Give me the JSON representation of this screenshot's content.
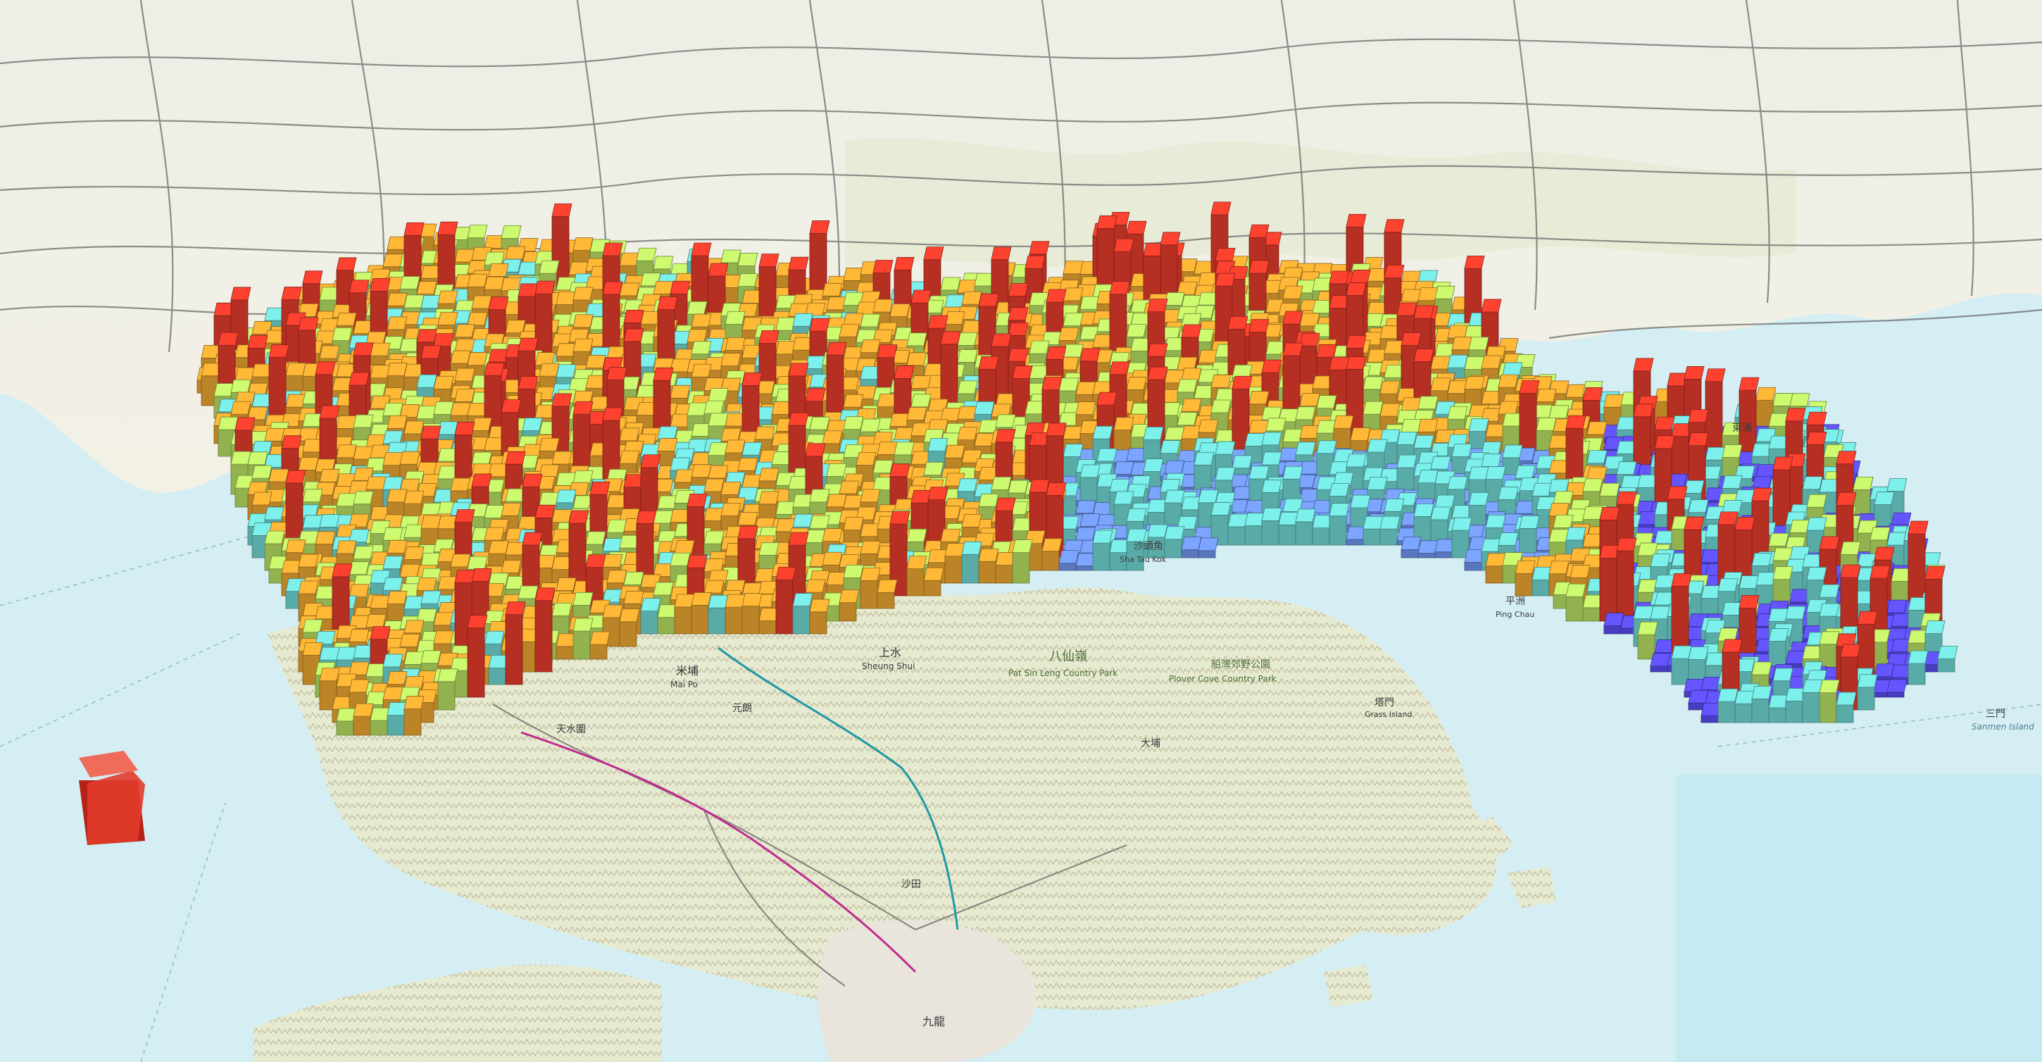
{
  "map": {
    "colors": {
      "water": "#d4eef3",
      "water_deep": "#bfe7ef",
      "land": "#f2f0e6",
      "land_green": "#dfe9c8",
      "hills": "#c9c2a6",
      "roads": "#6d6d6d",
      "rail_magenta": "#c02a8f",
      "rail_teal": "#1f99a4"
    },
    "extrusion_palette": [
      "#5a4cf0",
      "#6f93ee",
      "#6fd6d2",
      "#b7df63",
      "#e9a531",
      "#e23b2b"
    ],
    "labels": [
      {
        "id": "label-mai-po",
        "text": "米埔"
      },
      {
        "id": "label-mai-po-en",
        "text": "Mai Po"
      },
      {
        "id": "label-sheung-shui",
        "text": "上水"
      },
      {
        "id": "label-sheung-shui-en",
        "text": "Sheung Shui"
      },
      {
        "id": "label-pat-sin-leng",
        "text": "八仙嶺"
      },
      {
        "id": "label-pat-sin-leng-en",
        "text": "Pat Sin Leng Country Park"
      },
      {
        "id": "label-plover-cove",
        "text": "船灣郊野公園"
      },
      {
        "id": "label-plover-cove-en",
        "text": "Plover Cove Country Park"
      },
      {
        "id": "label-ping-chau",
        "text": "平洲"
      },
      {
        "id": "label-ping-chau-en",
        "text": "Ping Chau"
      },
      {
        "id": "label-grass-island",
        "text": "塔門"
      },
      {
        "id": "label-grass-island-en",
        "text": "Grass Island"
      },
      {
        "id": "label-tin-shui-wai",
        "text": "天水圍"
      },
      {
        "id": "label-yuen-long",
        "text": "元朗"
      },
      {
        "id": "label-tai-po",
        "text": "大埔"
      },
      {
        "id": "label-sha-tin",
        "text": "沙田"
      },
      {
        "id": "label-kowloon",
        "text": "九龍"
      },
      {
        "id": "label-sanmen-island",
        "text": "三門"
      },
      {
        "id": "label-sanmen-island-en",
        "text": "Sanmen Island"
      },
      {
        "id": "label-dongchong",
        "text": "東涌"
      },
      {
        "id": "label-sha-tau-kok",
        "text": "沙頭角"
      },
      {
        "id": "label-sha-tau-kok-en",
        "text": "Sha Tau Kok"
      }
    ]
  }
}
